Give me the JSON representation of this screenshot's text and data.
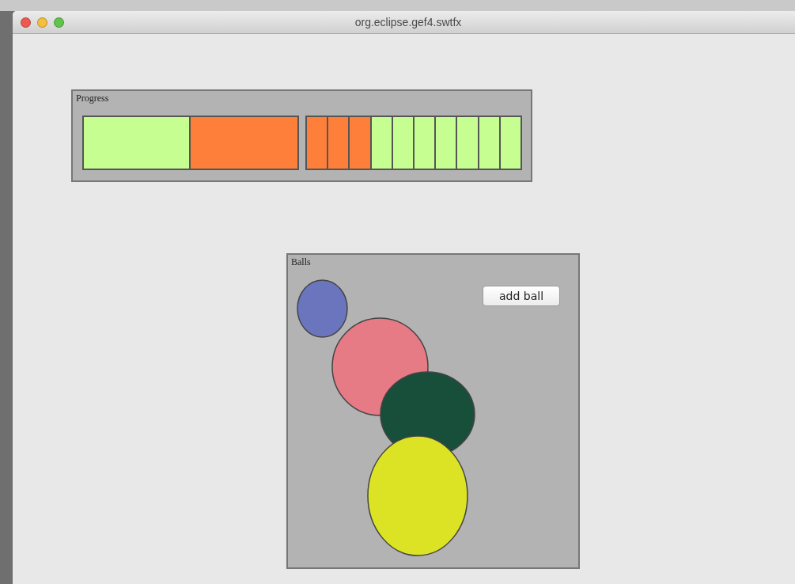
{
  "window": {
    "title": "org.eclipse.gef4.swtfx"
  },
  "progress": {
    "label": "Progress",
    "bar": {
      "level": 0.5
    },
    "cells": [
      {
        "color": "#fe7f3a"
      },
      {
        "color": "#fe7f3a"
      },
      {
        "color": "#fe7f3a"
      },
      {
        "color": "#c6fe92"
      },
      {
        "color": "#c6fe92"
      },
      {
        "color": "#c6fe92"
      },
      {
        "color": "#c6fe92"
      },
      {
        "color": "#c6fe92"
      },
      {
        "color": "#c6fe92"
      },
      {
        "color": "#c6fe92"
      }
    ]
  },
  "balls": {
    "label": "Balls",
    "button": "add ball",
    "items": [
      {
        "color": "#6b75bd"
      },
      {
        "color": "#e67a85"
      },
      {
        "color": "#174f3a"
      },
      {
        "color": "#dbe324"
      }
    ]
  }
}
